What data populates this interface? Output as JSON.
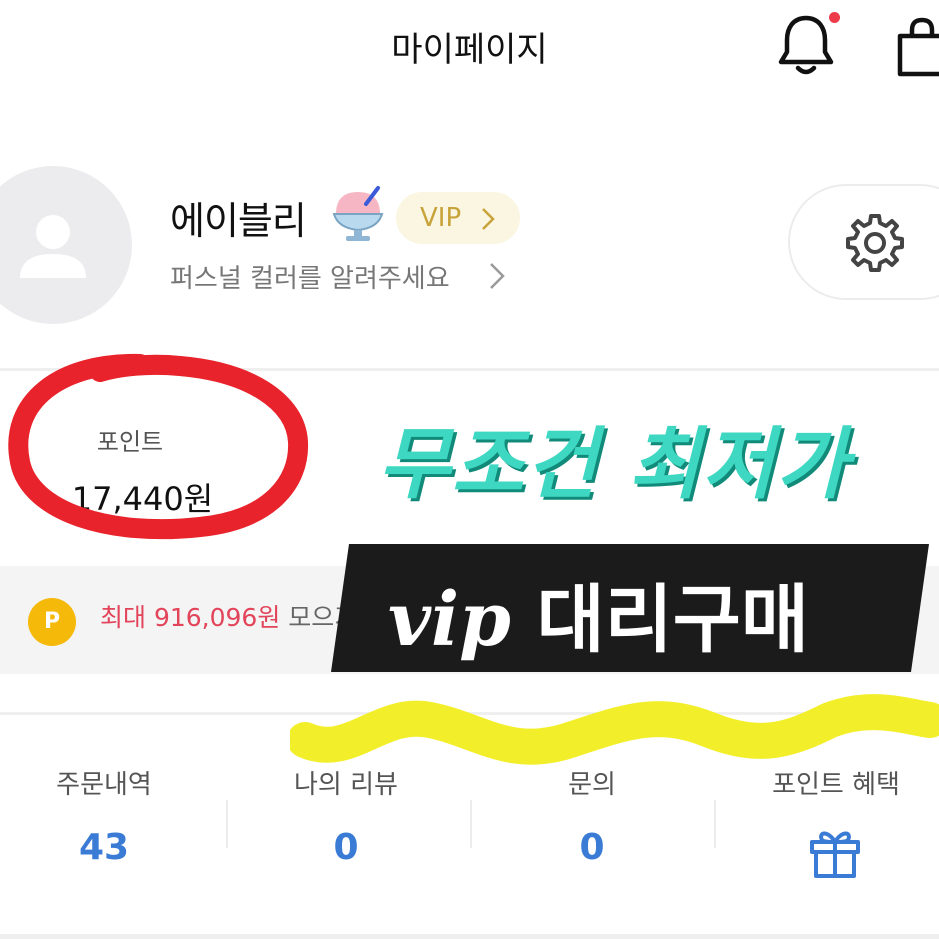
{
  "header": {
    "title": "마이페이지",
    "icons": [
      "bell-icon",
      "shopping-bag-icon"
    ],
    "notification_dot_color": "#ee3b4a"
  },
  "profile": {
    "nickname": "에이블리",
    "emoji_icon": "shaved-ice-icon",
    "badge": "VIP",
    "badge_color": "#c7a33a",
    "personal_color_link": "퍼스널 컬러를 알려주세요",
    "settings_icon": "gear-icon"
  },
  "points": {
    "label": "포인트",
    "value": "17,440원",
    "promo_prefix": "최대 916,096원",
    "promo_suffix": "모으기",
    "coin_letter": "P"
  },
  "overlay": {
    "headline": "무조건 최저가",
    "banner_latin": "vip",
    "banner_korean": "대리구매",
    "headline_color": "#3ed8c2"
  },
  "stats": [
    {
      "label": "주문내역",
      "value": "43"
    },
    {
      "label": "나의 리뷰",
      "value": "0"
    },
    {
      "label": "문의",
      "value": "0"
    },
    {
      "label": "포인트 혜택",
      "value_icon": "gift-icon"
    }
  ],
  "accent_color": "#3a7bd5"
}
